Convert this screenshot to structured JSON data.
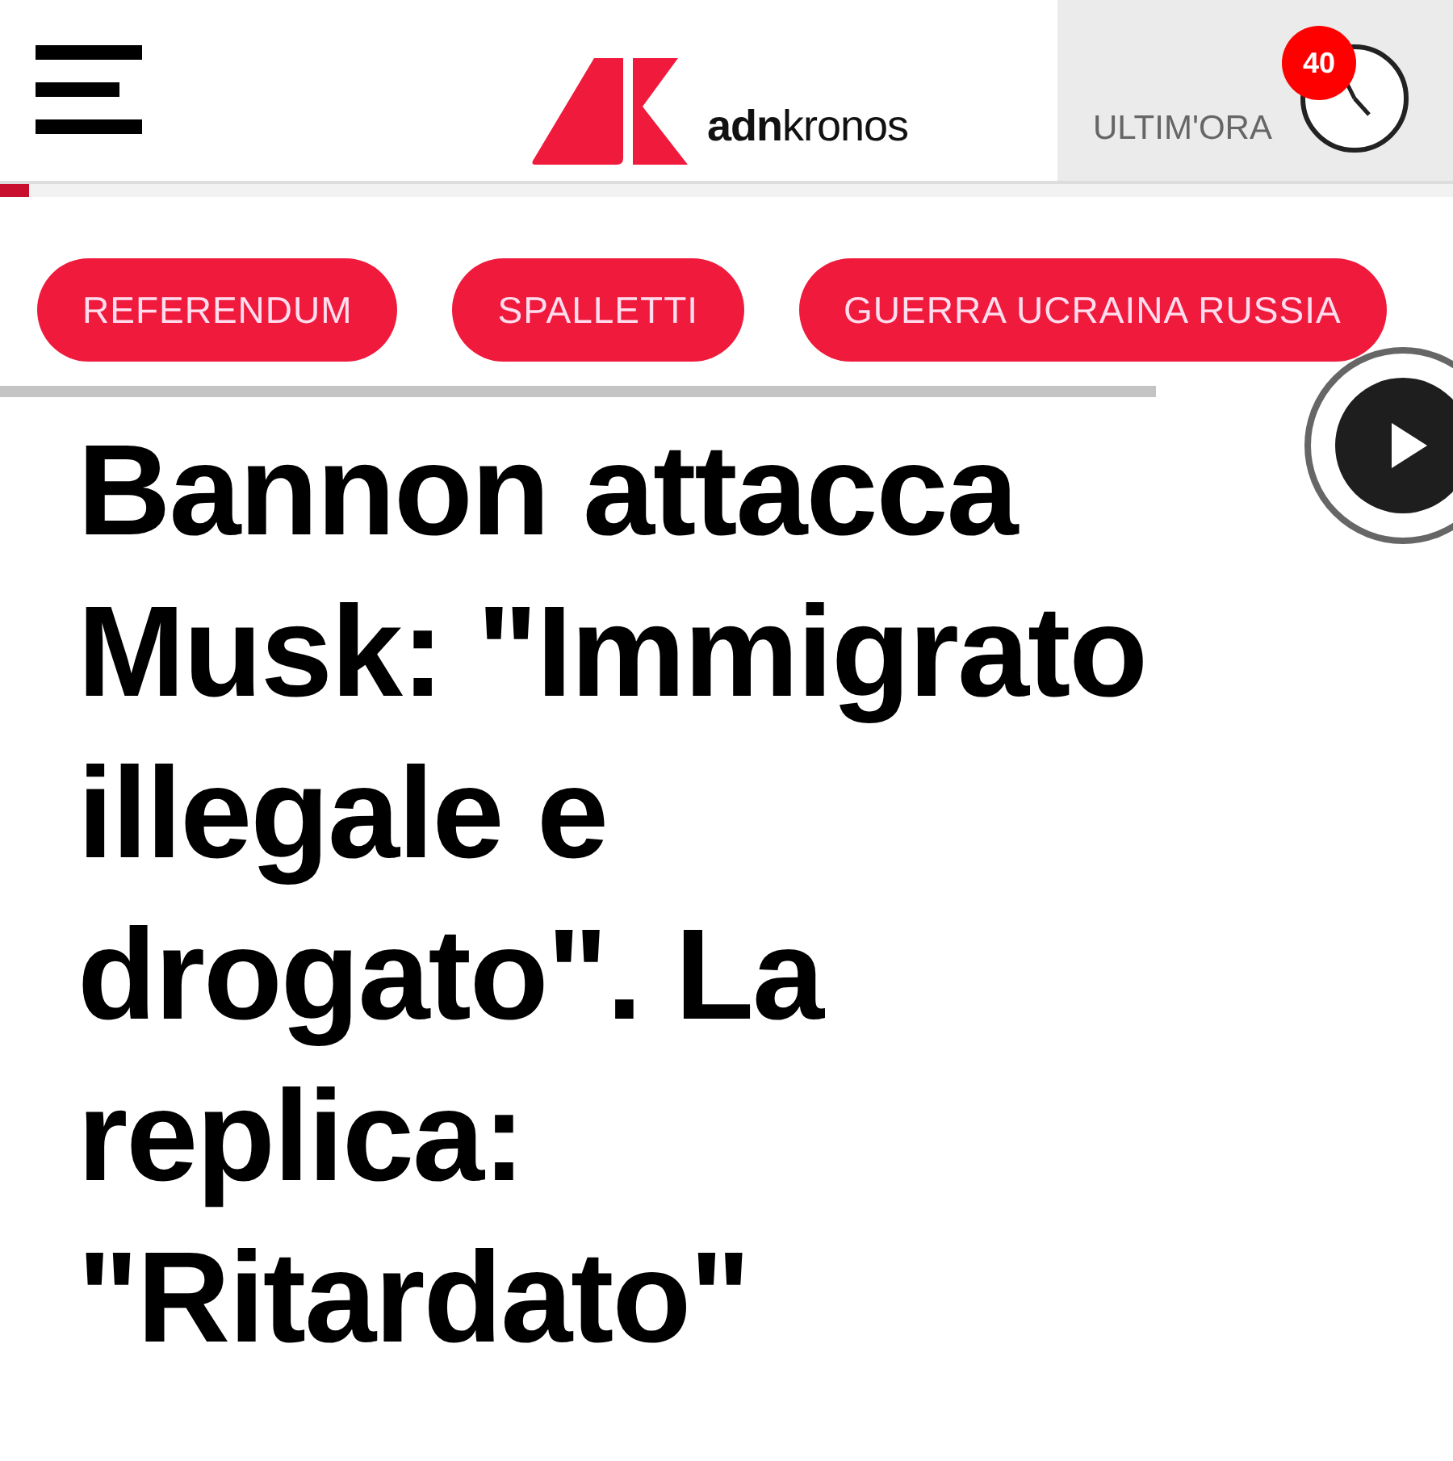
{
  "header": {
    "logo_text": "**adn**kronos",
    "breaking": {
      "label": "ULTIM'ORA",
      "count": "40"
    }
  },
  "reading_progress": {
    "level": 0.02
  },
  "tags": [
    {
      "label": "REFERENDUM"
    },
    {
      "label": "SPALLETTI"
    },
    {
      "label": "GUERRA UCRAINA RUSSIA"
    }
  ],
  "article": {
    "headline": "Bannon attacca Musk: \"Immigrato illegale e drogato\". La replica: \"Ritardato\""
  }
}
